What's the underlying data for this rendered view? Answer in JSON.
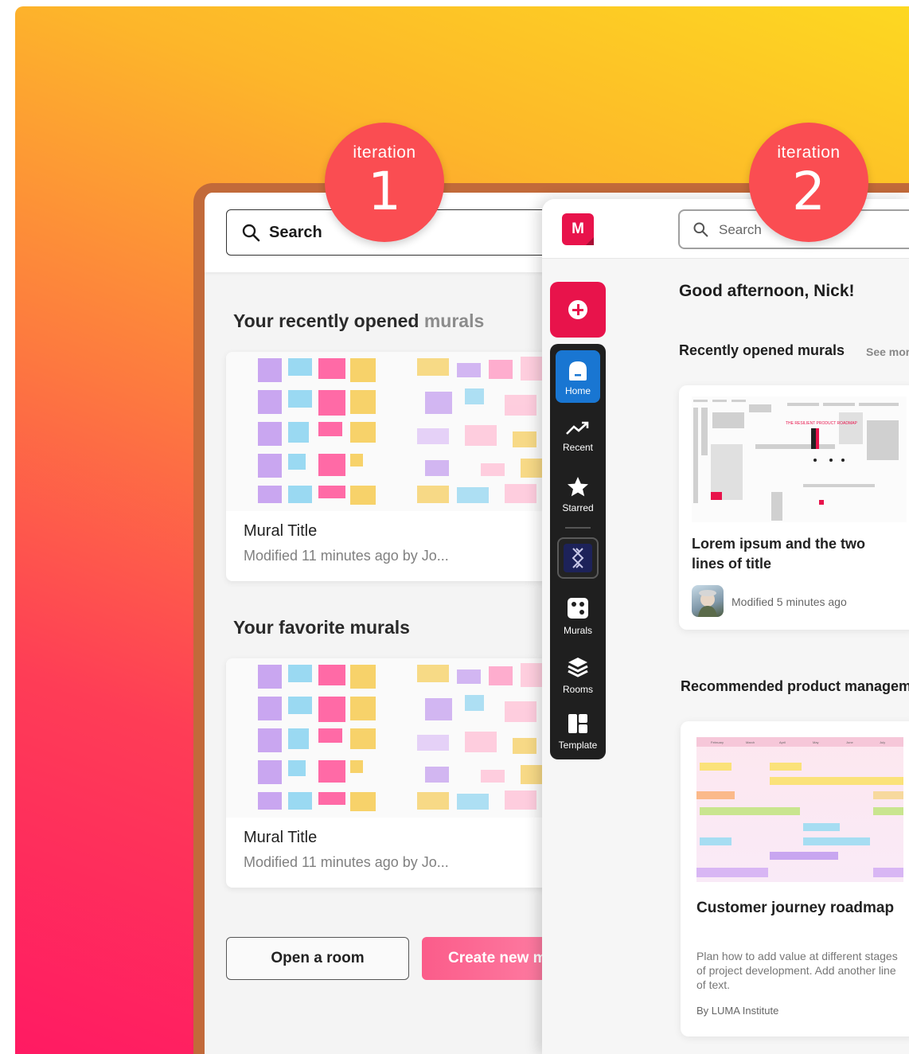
{
  "iteration1": {
    "badge_label": "iteration",
    "badge_number": "1",
    "search_placeholder": "Search",
    "recent_title_main": "Your recently opened ",
    "recent_title_muted": "murals",
    "favorites_title": "Your favorite murals",
    "cards": [
      {
        "title": "Mural Title",
        "meta": "Modified 11 minutes ago by Jo..."
      },
      {
        "title": "Mural Title",
        "meta": "Modified 11 minutes ago by Jo..."
      }
    ],
    "open_room_label": "Open a room",
    "create_new_label": "Create new m"
  },
  "iteration2": {
    "badge_label": "iteration",
    "badge_number": "2",
    "logo_letter": "M",
    "search_placeholder": "Search",
    "nav": [
      {
        "label": "Home",
        "icon": "home-icon"
      },
      {
        "label": "Recent",
        "icon": "trend-icon"
      },
      {
        "label": "Starred",
        "icon": "star-icon"
      },
      {
        "label": "Murals",
        "icon": "dice-icon"
      },
      {
        "label": "Rooms",
        "icon": "layers-icon"
      },
      {
        "label": "Template",
        "icon": "template-icon"
      }
    ],
    "greeting": "Good afternoon, Nick!",
    "recent_title": "Recently opened murals",
    "see_more": "See more",
    "recent_card": {
      "title": "Lorem ipsum and the two lines of title",
      "meta": "Modified 5 minutes ago",
      "thumb_text": "THE RESILIENT PRODUCT ROADMAP"
    },
    "recommended_title": "Recommended product management",
    "template_card": {
      "title": "Customer journey roadmap",
      "description": "Plan how to add value at different stages of project development. Add another line of text.",
      "author": "By LUMA Institute",
      "months": [
        "February",
        "March",
        "April",
        "May",
        "June",
        "July"
      ]
    }
  },
  "colors": {
    "badge": "#fa4d52",
    "brand": "#e8134b",
    "home_active": "#1976d2",
    "rail": "#1f1f1f"
  }
}
